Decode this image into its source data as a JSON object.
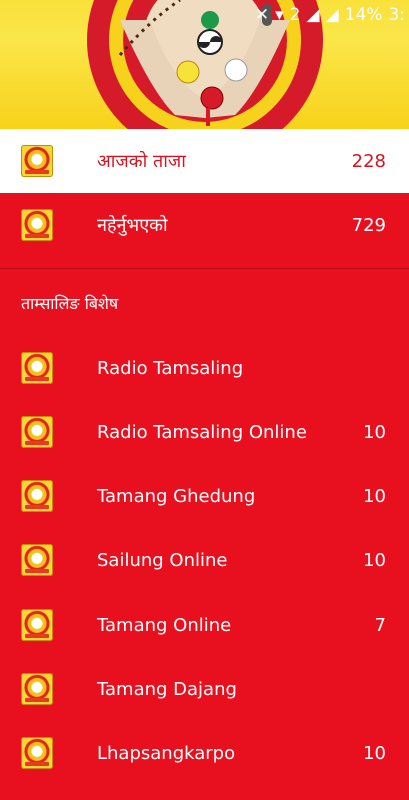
{
  "status_bar": {
    "battery": "14%",
    "time": "3:"
  },
  "colors": {
    "accent": "#e8101f",
    "header_yellow": "#f9e13a",
    "active_bg": "#ffffff",
    "active_text": "#d5141f"
  },
  "nav": {
    "items": [
      {
        "label": "आजको ताजा",
        "count": "228",
        "icon": "app-logo-icon"
      },
      {
        "label": "नहेर्नुभएको",
        "count": "729",
        "icon": "app-logo-icon"
      }
    ]
  },
  "section": {
    "title": "ताम्सालिङ बिशेष",
    "items": [
      {
        "label": "Radio Tamsaling",
        "count": ""
      },
      {
        "label": "Radio Tamsaling Online",
        "count": "10"
      },
      {
        "label": "Tamang Ghedung",
        "count": "10"
      },
      {
        "label": "Sailung Online",
        "count": "10"
      },
      {
        "label": "Tamang Online",
        "count": "7"
      },
      {
        "label": "Tamang Dajang",
        "count": ""
      },
      {
        "label": "Lhapsangkarpo",
        "count": "10"
      }
    ]
  }
}
